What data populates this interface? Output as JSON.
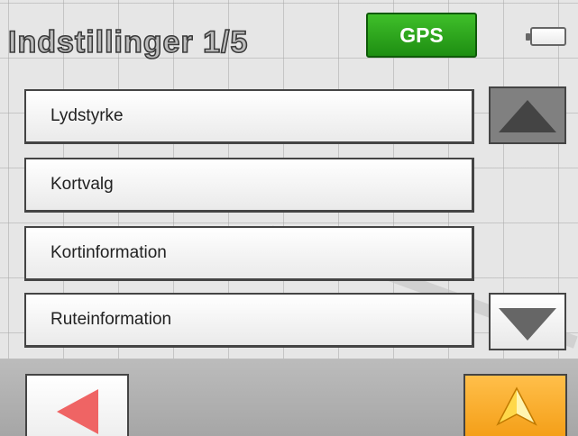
{
  "header": {
    "title": "Indstillinger 1/5",
    "gps_label": "GPS"
  },
  "menu": {
    "items": [
      {
        "label": "Lydstyrke"
      },
      {
        "label": "Kortvalg"
      },
      {
        "label": "Kortinformation"
      },
      {
        "label": "Ruteinformation"
      }
    ]
  },
  "colors": {
    "gps_accent": "#2aa81c",
    "back_arrow": "#ef6464",
    "map_button": "#f5a623"
  },
  "icons": {
    "scroll_up": "triangle-up-icon",
    "scroll_down": "triangle-down-icon",
    "back": "arrow-left-icon",
    "map": "navigation-arrow-icon",
    "battery": "battery-icon"
  }
}
